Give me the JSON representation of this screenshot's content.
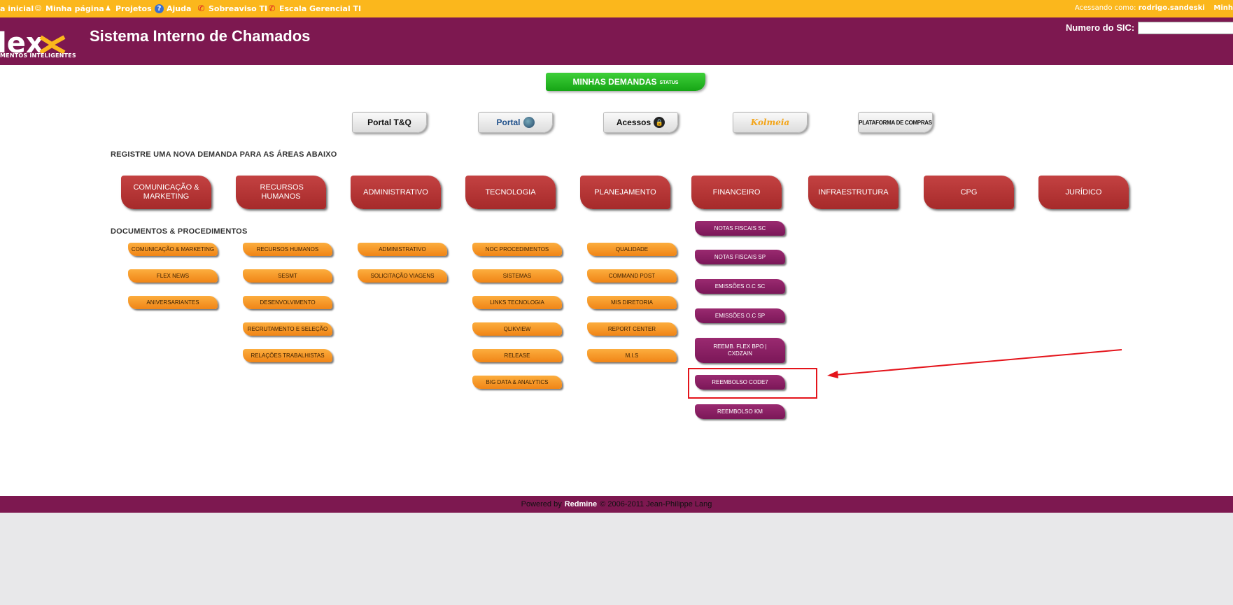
{
  "topbar": {
    "links": [
      {
        "label": "a inicial",
        "icon": "home-icon"
      },
      {
        "label": "Minha página",
        "icon": "user-icon"
      },
      {
        "label": "Projetos",
        "icon": "projects-icon"
      },
      {
        "label": "Ajuda",
        "icon": "help-icon"
      },
      {
        "label": "Sobreaviso TI",
        "icon": "phone-icon"
      },
      {
        "label": "Escala Gerencial TI",
        "icon": "phone-icon"
      }
    ],
    "login_prefix": "Acessando como:",
    "login_user": "rodrigo.sandeski",
    "login_more": "Minh"
  },
  "header": {
    "logo_text": "lex",
    "logo_subtitle": "MENTOS INTELIGENTES",
    "title": "Sistema Interno de Chamados",
    "sic_label": "Numero do SIC:",
    "sic_value": ""
  },
  "status_button": {
    "label": "MINHAS DEMANDAS",
    "sub": "STATUS"
  },
  "portals": [
    {
      "label": "Portal T&Q"
    },
    {
      "label": "Portal",
      "icon": "globe-icon"
    },
    {
      "label": "Acessos",
      "icon": "lock-icon"
    },
    {
      "label": "Kolmeia"
    },
    {
      "label": "PLATAFORMA DE COMPRAS"
    }
  ],
  "areas_title": "REGISTRE UMA NOVA DEMANDA PARA AS ÁREAS ABAIXO",
  "areas": [
    "COMUNICAÇÃO & MARKETING",
    "RECURSOS HUMANOS",
    "ADMINISTRATIVO",
    "TECNOLOGIA",
    "PLANEJAMENTO",
    "FINANCEIRO",
    "INFRAESTRUTURA",
    "CPG",
    "JURÍDICO"
  ],
  "docs_title": "DOCUMENTOS & PROCEDIMENTOS",
  "docs": {
    "comunicacao": [
      "COMUNICAÇÃO & MARKETING",
      "FLEX NEWS",
      "ANIVERSARIANTES"
    ],
    "rh": [
      "RECURSOS HUMANOS",
      "SESMT",
      "DESENVOLVIMENTO",
      "RECRUTAMENTO E SELEÇÃO",
      "RELAÇÕES TRABALHISTAS"
    ],
    "administrativo": [
      "ADMINISTRATIVO",
      "SOLICITAÇÃO VIAGENS"
    ],
    "tecnologia": [
      "NOC PROCEDIMENTOS",
      "SISTEMAS",
      "LINKS TECNOLOGIA",
      "QLIKVIEW",
      "RELEASE",
      "BIG DATA & ANALYTICS"
    ],
    "planejamento": [
      "QUALIDADE",
      "COMMAND POST",
      "MIS DIRETORIA",
      "REPORT CENTER",
      "M.I.S"
    ],
    "financeiro": [
      "NOTAS FISCAIS SC",
      "NOTAS FISCAIS SP",
      "EMISSÕES O.C SC",
      "EMISSÕES O.C SP",
      "REEMB. FLEX BPO | CXDZAIN",
      "REEMBOLSO CODE7",
      "REEMBOLSO KM"
    ]
  },
  "footer": {
    "prefix": "Powered by",
    "brand": "Redmine",
    "suffix": "© 2006-2011 Jean-Philippe Lang"
  },
  "colors": {
    "topbar": "#fbb71c",
    "header": "#7d1850",
    "area_button": "#b33434",
    "doc_button": "#f6961e",
    "finance_button": "#8a1e63",
    "status_button": "#22b11f",
    "highlight": "#e4141b"
  }
}
